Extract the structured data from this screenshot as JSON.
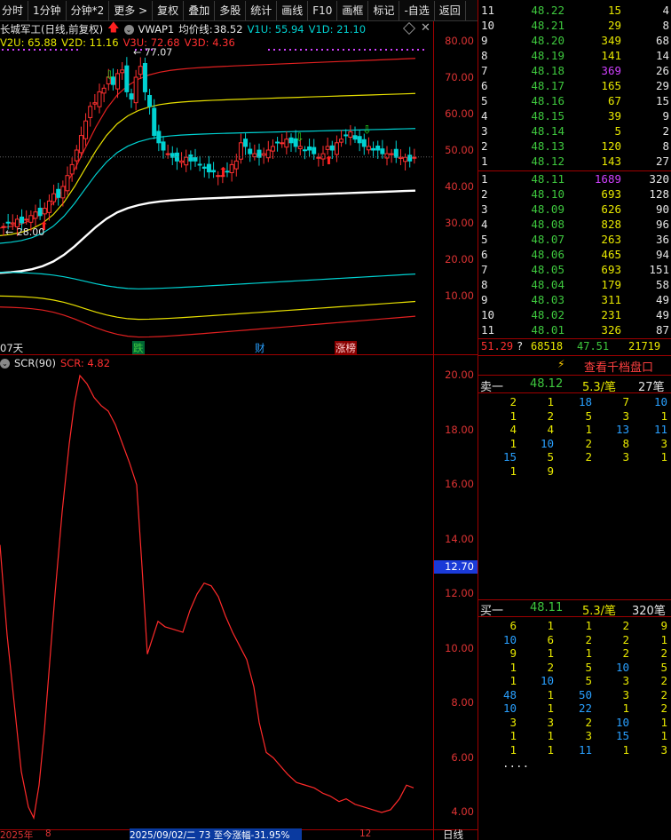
{
  "toolbar": {
    "buttons": [
      "分时",
      "1分钟",
      "分钟*2",
      "更多 >",
      "复权",
      "叠加",
      "多股",
      "统计",
      "画线",
      "F10",
      "画框",
      "标记",
      "-自选",
      "返回"
    ]
  },
  "main_chart": {
    "stock_name": "长城军工(日线,前复权)",
    "indicator_name": "VWAP1",
    "avg_line_label": "均价线:",
    "avg_line_value": "38.52",
    "v1u": "V1U: 55.94",
    "v1d": "V1D: 21.10",
    "v2u": "V2U: 65.88",
    "v2d": "V2D: 11.16",
    "v3u": "V3U: 72.68",
    "v3d": "V3D: 4.36",
    "high_marker": "77.07",
    "low_marker": "28.00",
    "y_ticks": [
      "80.00",
      "70.00",
      "60.00",
      "50.00",
      "40.00",
      "30.00",
      "20.00",
      "10.00"
    ],
    "bottom_labels": {
      "left": "07天",
      "event1": "跌",
      "event2": "财",
      "event3": "涨榜"
    }
  },
  "sub_chart": {
    "name": "SCR(90)",
    "value_label": "SCR: 4.82",
    "y_ticks": [
      "20.00",
      "18.00",
      "16.00",
      "14.00",
      "12.00",
      "10.00",
      "8.00",
      "6.00",
      "4.00"
    ],
    "current_value": "12.70"
  },
  "time_axis": {
    "year": "2025年",
    "m8": "8",
    "range_text": "2025/09/02/二  73 至今涨幅-31.95%",
    "m12": "12",
    "period": "日线"
  },
  "order_book": {
    "asks": [
      {
        "level": "11",
        "price": "48.22",
        "vol": "15",
        "count": "4"
      },
      {
        "level": "10",
        "price": "48.21",
        "vol": "29",
        "count": "8"
      },
      {
        "level": "9",
        "price": "48.20",
        "vol": "349",
        "count": "68"
      },
      {
        "level": "8",
        "price": "48.19",
        "vol": "141",
        "count": "14"
      },
      {
        "level": "7",
        "price": "48.18",
        "vol": "369",
        "count": "26"
      },
      {
        "level": "6",
        "price": "48.17",
        "vol": "165",
        "count": "29"
      },
      {
        "level": "5",
        "price": "48.16",
        "vol": "67",
        "count": "15"
      },
      {
        "level": "4",
        "price": "48.15",
        "vol": "39",
        "count": "9"
      },
      {
        "level": "3",
        "price": "48.14",
        "vol": "5",
        "count": "2"
      },
      {
        "level": "2",
        "price": "48.13",
        "vol": "120",
        "count": "8"
      },
      {
        "level": "1",
        "price": "48.12",
        "vol": "143",
        "count": "27"
      }
    ],
    "bids": [
      {
        "level": "1",
        "price": "48.11",
        "vol": "1689",
        "count": "320"
      },
      {
        "level": "2",
        "price": "48.10",
        "vol": "693",
        "count": "128"
      },
      {
        "level": "3",
        "price": "48.09",
        "vol": "626",
        "count": "90"
      },
      {
        "level": "4",
        "price": "48.08",
        "vol": "828",
        "count": "96"
      },
      {
        "level": "5",
        "price": "48.07",
        "vol": "263",
        "count": "36"
      },
      {
        "level": "6",
        "price": "48.06",
        "vol": "465",
        "count": "94"
      },
      {
        "level": "7",
        "price": "48.05",
        "vol": "693",
        "count": "151"
      },
      {
        "level": "8",
        "price": "48.04",
        "vol": "179",
        "count": "58"
      },
      {
        "level": "9",
        "price": "48.03",
        "vol": "311",
        "count": "49"
      },
      {
        "level": "10",
        "price": "48.02",
        "vol": "231",
        "count": "49"
      },
      {
        "level": "11",
        "price": "48.01",
        "vol": "326",
        "count": "87"
      }
    ],
    "summary": {
      "a": "51.29",
      "q": "?",
      "b": "68518",
      "c": "47.51",
      "d": "21719"
    }
  },
  "queue_panel": {
    "title": "查看千档盘口",
    "sell_label": "卖一",
    "sell_price": "48.12",
    "sell_avg": "5.3/笔",
    "sell_count": "27笔",
    "sell_rows": [
      [
        "2",
        "1",
        "18",
        "7",
        "10"
      ],
      [
        "1",
        "2",
        "5",
        "3",
        "1"
      ],
      [
        "4",
        "4",
        "1",
        "13",
        "11"
      ],
      [
        "1",
        "10",
        "2",
        "8",
        "3"
      ],
      [
        "15",
        "5",
        "2",
        "3",
        "1"
      ],
      [
        "1",
        "9",
        "",
        "",
        ""
      ]
    ],
    "buy_label": "买一",
    "buy_price": "48.11",
    "buy_avg": "5.3/笔",
    "buy_count": "320笔",
    "buy_rows": [
      [
        "6",
        "1",
        "1",
        "2",
        "9"
      ],
      [
        "10",
        "6",
        "2",
        "2",
        "1"
      ],
      [
        "9",
        "1",
        "1",
        "2",
        "2"
      ],
      [
        "1",
        "2",
        "5",
        "10",
        "5"
      ],
      [
        "1",
        "10",
        "5",
        "3",
        "2"
      ],
      [
        "48",
        "1",
        "50",
        "3",
        "2"
      ],
      [
        "10",
        "1",
        "22",
        "1",
        "2"
      ],
      [
        "3",
        "3",
        "2",
        "10",
        "1"
      ],
      [
        "1",
        "1",
        "3",
        "15",
        "1"
      ],
      [
        "1",
        "1",
        "11",
        "1",
        "3"
      ],
      [
        "....",
        "",
        "",
        "",
        ""
      ]
    ]
  },
  "colors": {
    "up": "#ff3030",
    "down": "#00d2d2",
    "bid_green": "#3ec83e",
    "vol_yellow": "#e8e800",
    "blue_hi": "#29a0ff"
  }
}
